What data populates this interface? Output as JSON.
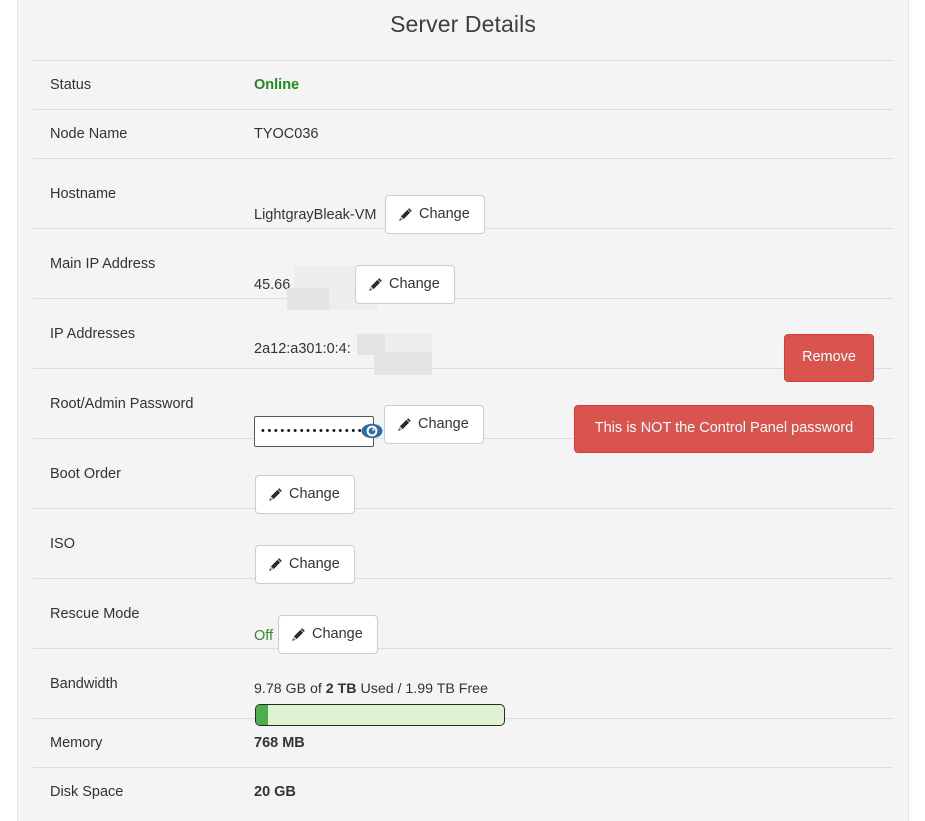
{
  "panel": {
    "title": "Server Details"
  },
  "colors": {
    "panel_bg": "#f4f4f4",
    "danger": "#d9534f",
    "danger_border": "#d43f3a",
    "online_green": "#1f8a1f",
    "progress_fill": "#4cae4c",
    "progress_track": "#ddf3d3",
    "row_divider": "#dddddd",
    "eye_icon_blue": "#2e6da4"
  },
  "icons": {
    "pencil": "pencil-icon",
    "eye": "eye-reveal-password-icon"
  },
  "labels": {
    "status": "Status",
    "node_name": "Node Name",
    "hostname": "Hostname",
    "main_ip": "Main IP Address",
    "ip_addresses": "IP Addresses",
    "root_password": "Root/Admin Password",
    "boot_order": "Boot Order",
    "iso": "ISO",
    "rescue_mode": "Rescue Mode",
    "bandwidth": "Bandwidth",
    "memory": "Memory",
    "disk_space": "Disk Space"
  },
  "values": {
    "status": "Online",
    "node_name": "TYOC036",
    "hostname": "LightgrayBleak-VM",
    "main_ip": "45.66",
    "ip_address_v6": "2a12:a301:0:4:",
    "password_masked": "••••••••••••••••••",
    "rescue_mode": "Off",
    "memory": "768 MB",
    "disk_space": "20 GB"
  },
  "buttons": {
    "change": "Change",
    "remove": "Remove",
    "password_warning": "This is NOT the Control Panel password"
  },
  "bandwidth": {
    "used": "9.78 GB",
    "total": "2 TB",
    "free": "1.99 TB",
    "text_prefix": "9.78 GB of ",
    "text_total": "2 TB",
    "text_suffix": " Used / 1.99 TB Free",
    "percent_used": 5
  }
}
